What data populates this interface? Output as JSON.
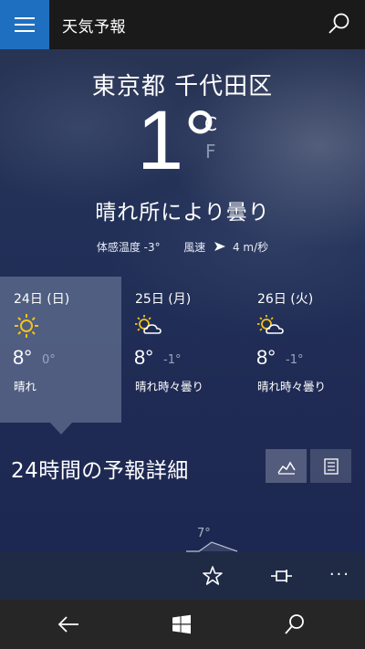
{
  "app": {
    "title": "天気予報"
  },
  "current": {
    "location": "東京都 千代田区",
    "temperature": "1°",
    "unit_c": "C",
    "unit_f": "F",
    "condition": "晴れ所により曇り",
    "feels_like_label": "体感温度",
    "feels_like_value": "-3°",
    "wind_label": "風速",
    "wind_value": "4 m/秒"
  },
  "days": [
    {
      "date": "24日 (日)",
      "icon": "sun-icon",
      "high": "8°",
      "low": "0°",
      "desc": "晴れ",
      "selected": true
    },
    {
      "date": "25日 (月)",
      "icon": "partly-cloudy-icon",
      "high": "8°",
      "low": "-1°",
      "desc": "晴れ時々曇り",
      "selected": false
    },
    {
      "date": "26日 (火)",
      "icon": "partly-cloudy-icon",
      "high": "8°",
      "low": "-1°",
      "desc": "晴れ時々曇り",
      "selected": false
    }
  ],
  "hourly": {
    "title": "24時間の予報詳細",
    "first_temp": "7°",
    "views": [
      {
        "icon": "line-chart-icon",
        "active": true
      },
      {
        "icon": "list-icon",
        "active": false
      }
    ]
  },
  "colors": {
    "accent": "#1f6fc1",
    "sun": "#f2c21b",
    "selected_card": "#78879f"
  }
}
